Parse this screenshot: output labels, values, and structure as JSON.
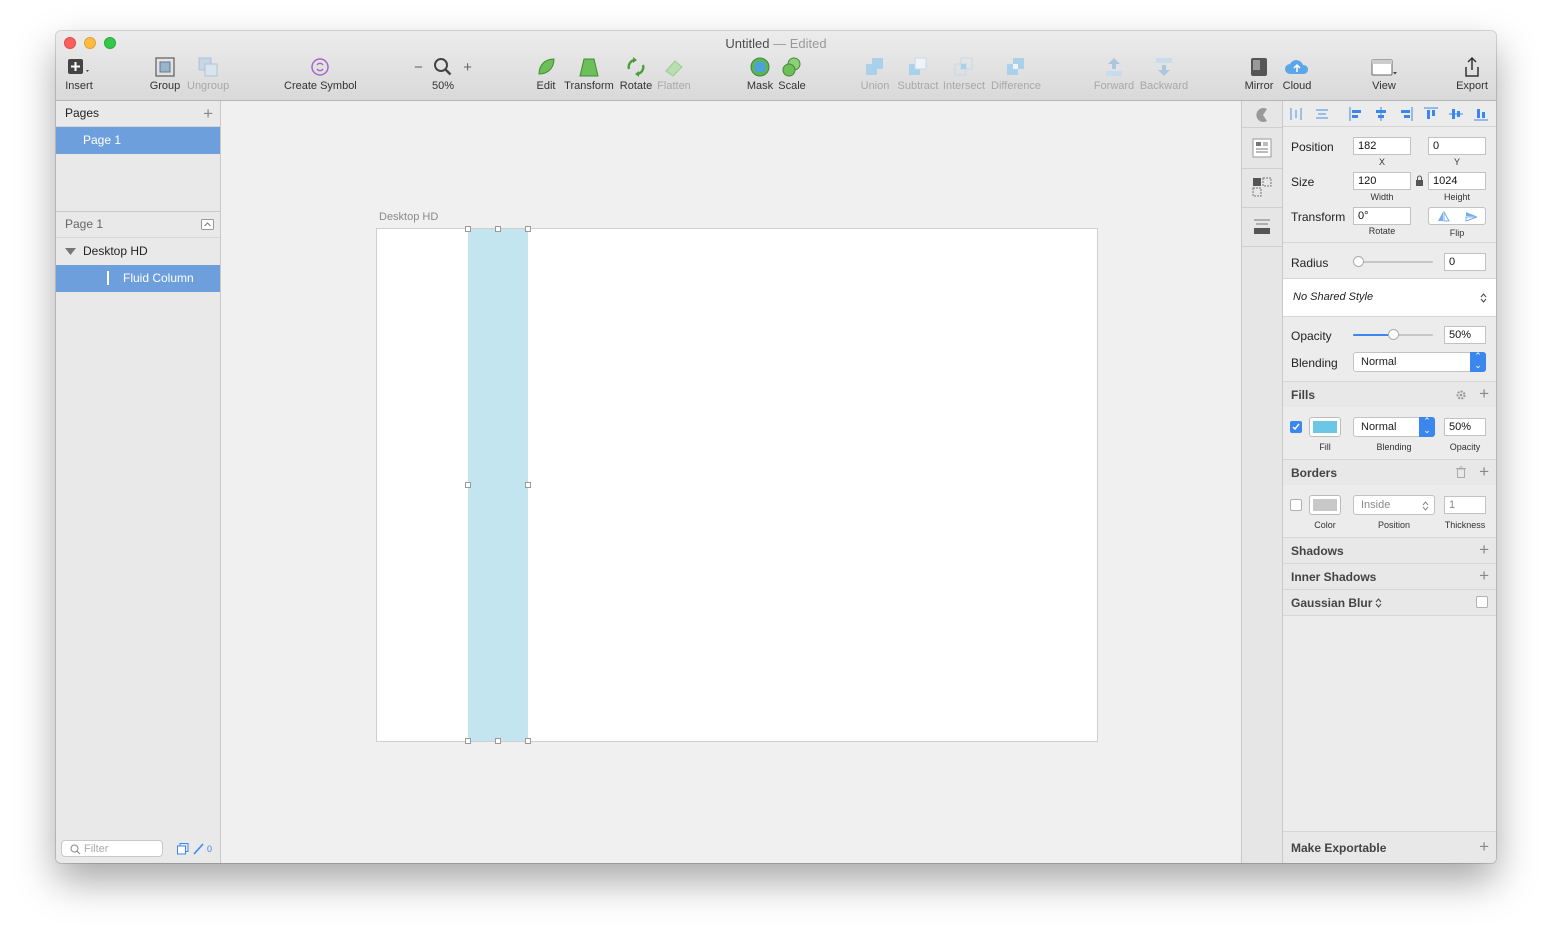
{
  "window": {
    "title": "Untitled",
    "separator": "—",
    "status": "Edited"
  },
  "toolbar": {
    "insert": "Insert",
    "group": "Group",
    "ungroup": "Ungroup",
    "create_symbol": "Create Symbol",
    "zoom": "50%",
    "edit": "Edit",
    "transform": "Transform",
    "rotate": "Rotate",
    "flatten": "Flatten",
    "mask": "Mask",
    "scale": "Scale",
    "union": "Union",
    "subtract": "Subtract",
    "intersect": "Intersect",
    "difference": "Difference",
    "forward": "Forward",
    "backward": "Backward",
    "mirror": "Mirror",
    "cloud": "Cloud",
    "view": "View",
    "export": "Export",
    "zoom_minus": "−",
    "zoom_plus": "+"
  },
  "pages": {
    "header": "Pages",
    "items": [
      "Page 1"
    ]
  },
  "layers": {
    "header": "Page 1",
    "artboard": "Desktop HD",
    "child": "Fluid Column"
  },
  "filter": {
    "placeholder": "Filter",
    "count": "0"
  },
  "canvas": {
    "artboard_label": "Desktop HD"
  },
  "inspector": {
    "position_label": "Position",
    "x": "182",
    "y": "0",
    "x_label": "X",
    "y_label": "Y",
    "size_label": "Size",
    "width": "120",
    "height": "1024",
    "width_label": "Width",
    "height_label": "Height",
    "transform_label": "Transform",
    "rotate": "0°",
    "rotate_label": "Rotate",
    "flip_label": "Flip",
    "radius_label": "Radius",
    "radius": "0",
    "shared_style": "No Shared Style",
    "opacity_label": "Opacity",
    "opacity": "50%",
    "blending_label": "Blending",
    "blending": "Normal",
    "fills_title": "Fills",
    "fill_label": "Fill",
    "fill_blending": "Normal",
    "fill_blending_label": "Blending",
    "fill_opacity": "50%",
    "fill_opacity_label": "Opacity",
    "borders_title": "Borders",
    "border_color_label": "Color",
    "border_position": "Inside",
    "border_position_label": "Position",
    "border_thickness": "1",
    "border_thickness_label": "Thickness",
    "shadows_title": "Shadows",
    "inner_shadows_title": "Inner Shadows",
    "gaussian_blur_title": "Gaussian Blur",
    "make_exportable": "Make Exportable"
  },
  "colors": {
    "accent": "#3b87ee",
    "selection": "#6e9fdd",
    "column_fill": "#c3e5f0",
    "fill_swatch": "#6cc7e6"
  },
  "levels": {
    "radius_slider": 0,
    "opacity_slider": 0.5
  }
}
